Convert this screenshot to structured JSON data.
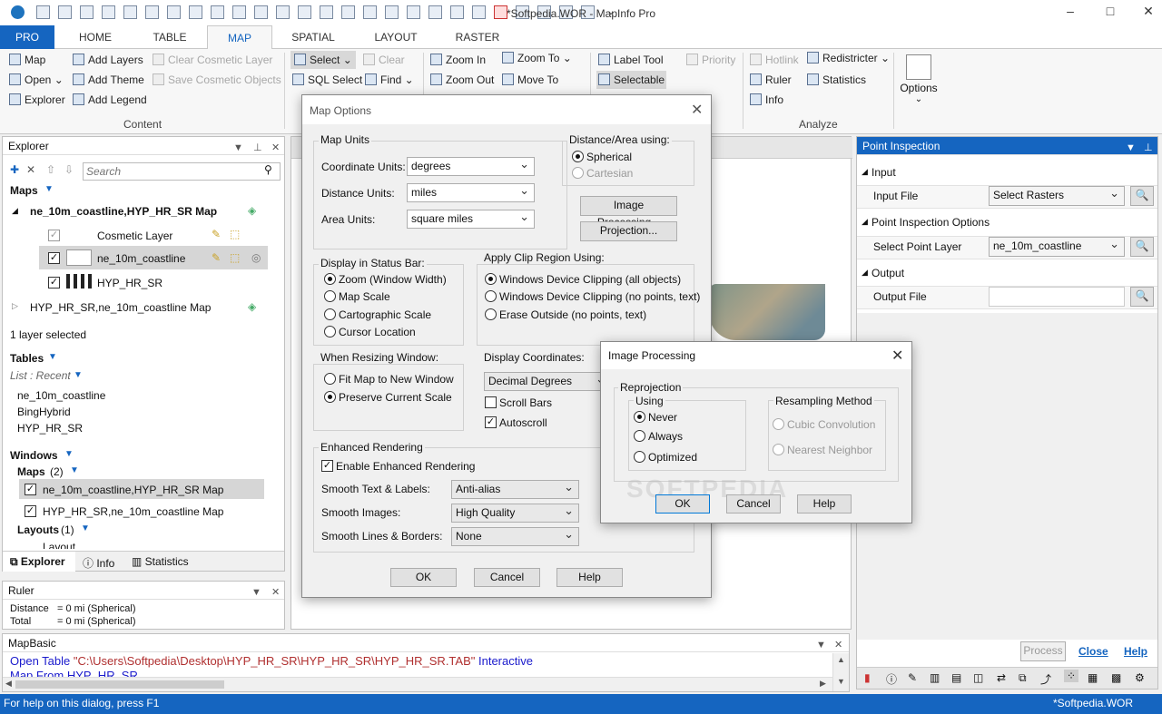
{
  "window": {
    "title": "*Softpedia.WOR - MapInfo Pro"
  },
  "tabs": [
    "PRO",
    "HOME",
    "TABLE",
    "MAP",
    "SPATIAL",
    "LAYOUT",
    "RASTER"
  ],
  "ribbon": {
    "map": "Map",
    "open": "Open",
    "explorer": "Explorer",
    "add_layers": "Add Layers",
    "add_theme": "Add Theme",
    "add_legend": "Add Legend",
    "clear_cosmetic": "Clear Cosmetic Layer",
    "save_cosmetic": "Save Cosmetic Objects",
    "content_label": "Content",
    "select": "Select",
    "clear": "Clear",
    "sql_select": "SQL Select",
    "find": "Find",
    "zoom_in": "Zoom In",
    "zoom_to": "Zoom To",
    "zoom_out": "Zoom Out",
    "move_to": "Move To",
    "label_tool": "Label Tool",
    "priority": "Priority",
    "selectable": "Selectable",
    "hotlink": "Hotlink",
    "redistricter": "Redistricter",
    "ruler": "Ruler",
    "statistics": "Statistics",
    "info": "Info",
    "analyze_label": "Analyze",
    "options": "Options"
  },
  "explorer": {
    "title": "Explorer",
    "search_placeholder": "Search",
    "maps_header": "Maps",
    "map1": "ne_10m_coastline,HYP_HR_SR Map",
    "layer_cosmetic": "Cosmetic Layer",
    "layer_coast": "ne_10m_coastline",
    "layer_hyp": "HYP_HR_SR",
    "map2": "HYP_HR_SR,ne_10m_coastline Map",
    "selected_info": "1 layer selected",
    "tables_header": "Tables",
    "list_recent": "List : Recent",
    "tables": [
      "ne_10m_coastline",
      "BingHybrid",
      "HYP_HR_SR"
    ],
    "windows_header": "Windows",
    "maps_count_label": "Maps",
    "maps_count": "(2)",
    "win_map1": "ne_10m_coastline,HYP_HR_SR Map",
    "win_map2": "HYP_HR_SR,ne_10m_coastline Map",
    "layouts_label": "Layouts",
    "layouts_count": "(1)",
    "layout_item": "Layout",
    "tab_explorer": "Explorer",
    "tab_info": "Info",
    "tab_statistics": "Statistics"
  },
  "ruler": {
    "title": "Ruler",
    "distance_label": "Distance",
    "distance_value": "= 0 mi (Spherical)",
    "total_label": "Total",
    "total_value": "= 0 mi (Spherical)"
  },
  "mapbasic": {
    "title": "MapBasic",
    "cmd_kw": "Open Table",
    "cmd_path": "\"C:\\Users\\Softpedia\\Desktop\\HYP_HR_SR\\HYP_HR_SR\\HYP_HR_SR.TAB\"",
    "cmd_tail": "Interactive",
    "cmd2": "Map From HYP_HR_SR"
  },
  "map_options": {
    "title": "Map Options",
    "map_units": "Map Units",
    "coord_label": "Coordinate Units:",
    "coord_value": "degrees",
    "dist_label": "Distance Units:",
    "dist_value": "miles",
    "area_label": "Area Units:",
    "area_value": "square miles",
    "distarea": "Distance/Area using:",
    "spherical": "Spherical",
    "cartesian": "Cartesian",
    "image_processing_btn": "Image Processing...",
    "projection_btn": "Projection...",
    "status_bar": "Display in Status Bar:",
    "zoom": "Zoom (Window Width)",
    "map_scale": "Map Scale",
    "carto_scale": "Cartographic Scale",
    "cursor_loc": "Cursor Location",
    "clip": "Apply Clip Region Using:",
    "clip_all": "Windows Device Clipping (all objects)",
    "clip_nopts": "Windows Device Clipping (no points, text)",
    "erase": "Erase Outside (no points, text)",
    "resizing": "When Resizing Window:",
    "fit": "Fit Map to New Window",
    "preserve": "Preserve Current Scale",
    "display_coords": "Display Coordinates:",
    "decimal_degrees": "Decimal Degrees",
    "scroll_bars": "Scroll Bars",
    "autoscroll": "Autoscroll",
    "enhanced": "Enhanced Rendering",
    "enable_enhanced": "Enable Enhanced Rendering",
    "smooth_text": "Smooth Text & Labels:",
    "smooth_text_val": "Anti-alias",
    "smooth_images": "Smooth Images:",
    "smooth_images_val": "High Quality",
    "smooth_lines": "Smooth Lines & Borders:",
    "smooth_lines_val": "None",
    "ok": "OK",
    "cancel": "Cancel",
    "help": "Help"
  },
  "image_processing": {
    "title": "Image Processing",
    "reprojection": "Reprojection",
    "using": "Using",
    "never": "Never",
    "always": "Always",
    "optimized": "Optimized",
    "resampling": "Resampling Method",
    "cubic": "Cubic Convolution",
    "nearest": "Nearest Neighbor",
    "ok": "OK",
    "cancel": "Cancel",
    "help": "Help",
    "watermark": "SOFTPEDIA"
  },
  "point_inspection": {
    "title": "Point Inspection",
    "input": "Input",
    "input_file": "Input File",
    "input_value": "Select Rasters",
    "options": "Point Inspection Options",
    "select_layer": "Select Point Layer",
    "layer_value": "ne_10m_coastline",
    "output": "Output",
    "output_file": "Output File",
    "process": "Process",
    "close": "Close",
    "help": "Help"
  },
  "status": {
    "left": "For help on this dialog, press F1",
    "right": "*Softpedia.WOR"
  }
}
